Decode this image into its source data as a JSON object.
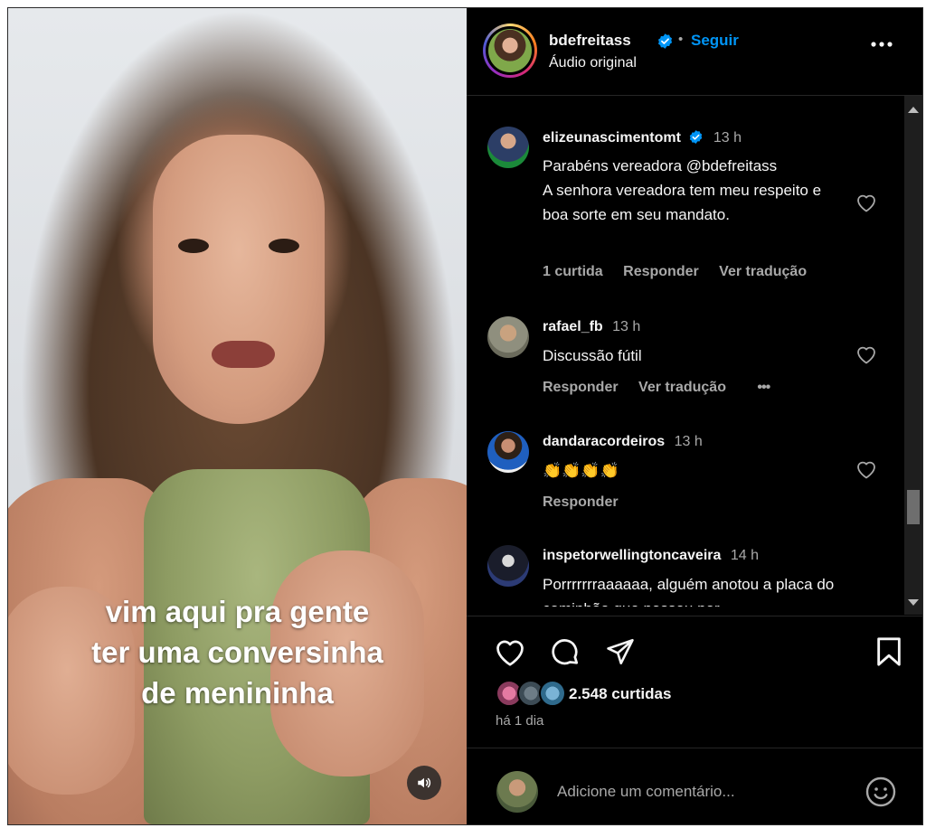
{
  "video": {
    "caption_lines": [
      "vim aqui pra gente",
      "ter uma conversinha",
      "de menininha"
    ],
    "sound_icon": "speaker-icon"
  },
  "post_header": {
    "username": "bdefreitass",
    "verified_icon": "verified-badge-icon",
    "separator": "•",
    "follow_label": "Seguir",
    "audio_label": "Áudio original",
    "more_icon": "more-options-icon"
  },
  "comments": [
    {
      "username": "elizeunascimentomt",
      "verified": true,
      "time": "13 h",
      "text": "Parabéns vereadora @bdefreitass\nA senhora vereadora tem meu respeito e boa sorte em seu mandato.",
      "likes_label": "1 curtida",
      "reply_label": "Responder",
      "translate_label": "Ver tradução"
    },
    {
      "username": "rafael_fb",
      "time": "13 h",
      "text": "Discussão fútil",
      "reply_label": "Responder",
      "translate_label": "Ver tradução",
      "more": "•••"
    },
    {
      "username": "dandaracordeiros",
      "time": "13 h",
      "text": "👏👏👏👏",
      "reply_label": "Responder"
    },
    {
      "username": "inspetorwellingtoncaveira",
      "time": "14 h",
      "text": "Porrrrrrraaaaaa, alguém anotou a placa do caminhão que passou por"
    }
  ],
  "actions": {
    "like_icon": "heart-icon",
    "comment_icon": "comment-icon",
    "share_icon": "send-icon",
    "save_icon": "bookmark-icon"
  },
  "likes": {
    "count_label": "2.548 curtidas"
  },
  "posted_label": "há 1 dia",
  "add_comment": {
    "placeholder": "Adicione um comentário...",
    "emoji_icon": "emoji-icon"
  },
  "colors": {
    "background": "#000000",
    "text": "#f5f5f5",
    "secondary": "#a8a8a8",
    "link_blue": "#0095f6",
    "verified": "#0095f6"
  }
}
